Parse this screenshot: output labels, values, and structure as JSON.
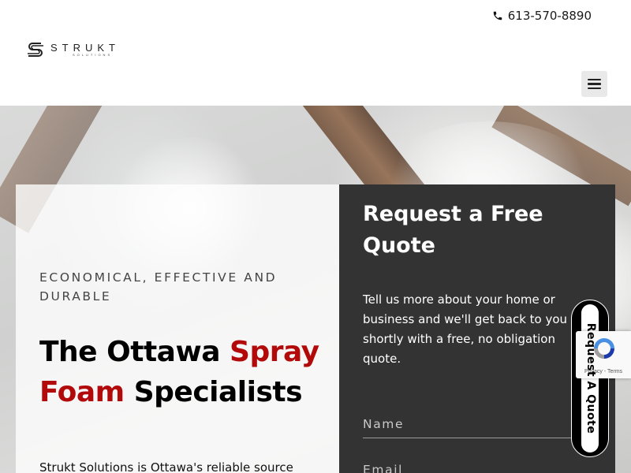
{
  "topbar": {
    "phone": "613-570-8890",
    "phone_icon": "phone-icon"
  },
  "header": {
    "logo_name": "STRUKT",
    "logo_sub": "SOLUTIONS",
    "menu_icon": "hamburger-menu-icon"
  },
  "hero": {
    "tagline": "ECONOMICAL, EFFECTIVE AND DURABLE",
    "headline_part1": "The Ottawa ",
    "headline_red1": "Spray",
    "headline_red2": "Foam",
    "headline_part2": " Specialists",
    "intro": "Strukt Solutions is Ottawa's reliable source",
    "accent_color": "#b20a0a"
  },
  "form": {
    "title": "Request a Free Quote",
    "description": "Tell us more about your home or business and we'll get back to you shortly with a free, no obligation quote.",
    "name_placeholder": "Name",
    "email_placeholder": "Email",
    "panel_color": "#333333"
  },
  "side_tab": {
    "label": "Request A Quote"
  },
  "recaptcha": {
    "links": "Privacy - Terms",
    "icon": "recaptcha-icon"
  }
}
